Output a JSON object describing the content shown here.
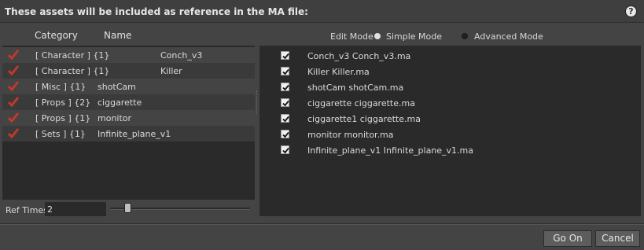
{
  "dialog": {
    "title": "These assets will be included as reference in the MA file:"
  },
  "left_panel": {
    "headers": {
      "category": "Category",
      "name": "Name"
    },
    "rows": [
      {
        "checked": true,
        "category": "[ Character ] {1}",
        "name": "Conch_v3"
      },
      {
        "checked": true,
        "category": "[ Character ] {1}",
        "name": "Killer"
      },
      {
        "checked": true,
        "category": "[ Misc ] {1}",
        "name": "shotCam"
      },
      {
        "checked": true,
        "category": "[ Props ] {2}",
        "name": "ciggarette"
      },
      {
        "checked": true,
        "category": "[ Props ] {1}",
        "name": "monitor"
      },
      {
        "checked": true,
        "category": "[ Sets ] {1}",
        "name": "Infinite_plane_v1"
      }
    ]
  },
  "edit_mode": {
    "label": "Edit Mode",
    "options": [
      {
        "label": "Simple Mode",
        "selected": true
      },
      {
        "label": "Advanced Mode",
        "selected": false
      }
    ]
  },
  "right_panel": {
    "items": [
      {
        "checked": true,
        "text": "Conch_v3  Conch_v3.ma"
      },
      {
        "checked": true,
        "text": "Killer  Killer.ma"
      },
      {
        "checked": true,
        "text": "shotCam  shotCam.ma"
      },
      {
        "checked": true,
        "text": "ciggarette  ciggarette.ma"
      },
      {
        "checked": true,
        "text": "ciggarette1  ciggarette.ma"
      },
      {
        "checked": true,
        "text": "monitor  monitor.ma"
      },
      {
        "checked": true,
        "text": "Infinite_plane_v1  Infinite_plane_v1.ma"
      }
    ]
  },
  "ref_times": {
    "label": "Ref Times",
    "value": "2"
  },
  "buttons": {
    "go_on": "Go On",
    "cancel": "Cancel"
  },
  "colors": {
    "checkmark_red": "#c0392b",
    "background": "#444444",
    "panel": "#2a2a2a"
  }
}
